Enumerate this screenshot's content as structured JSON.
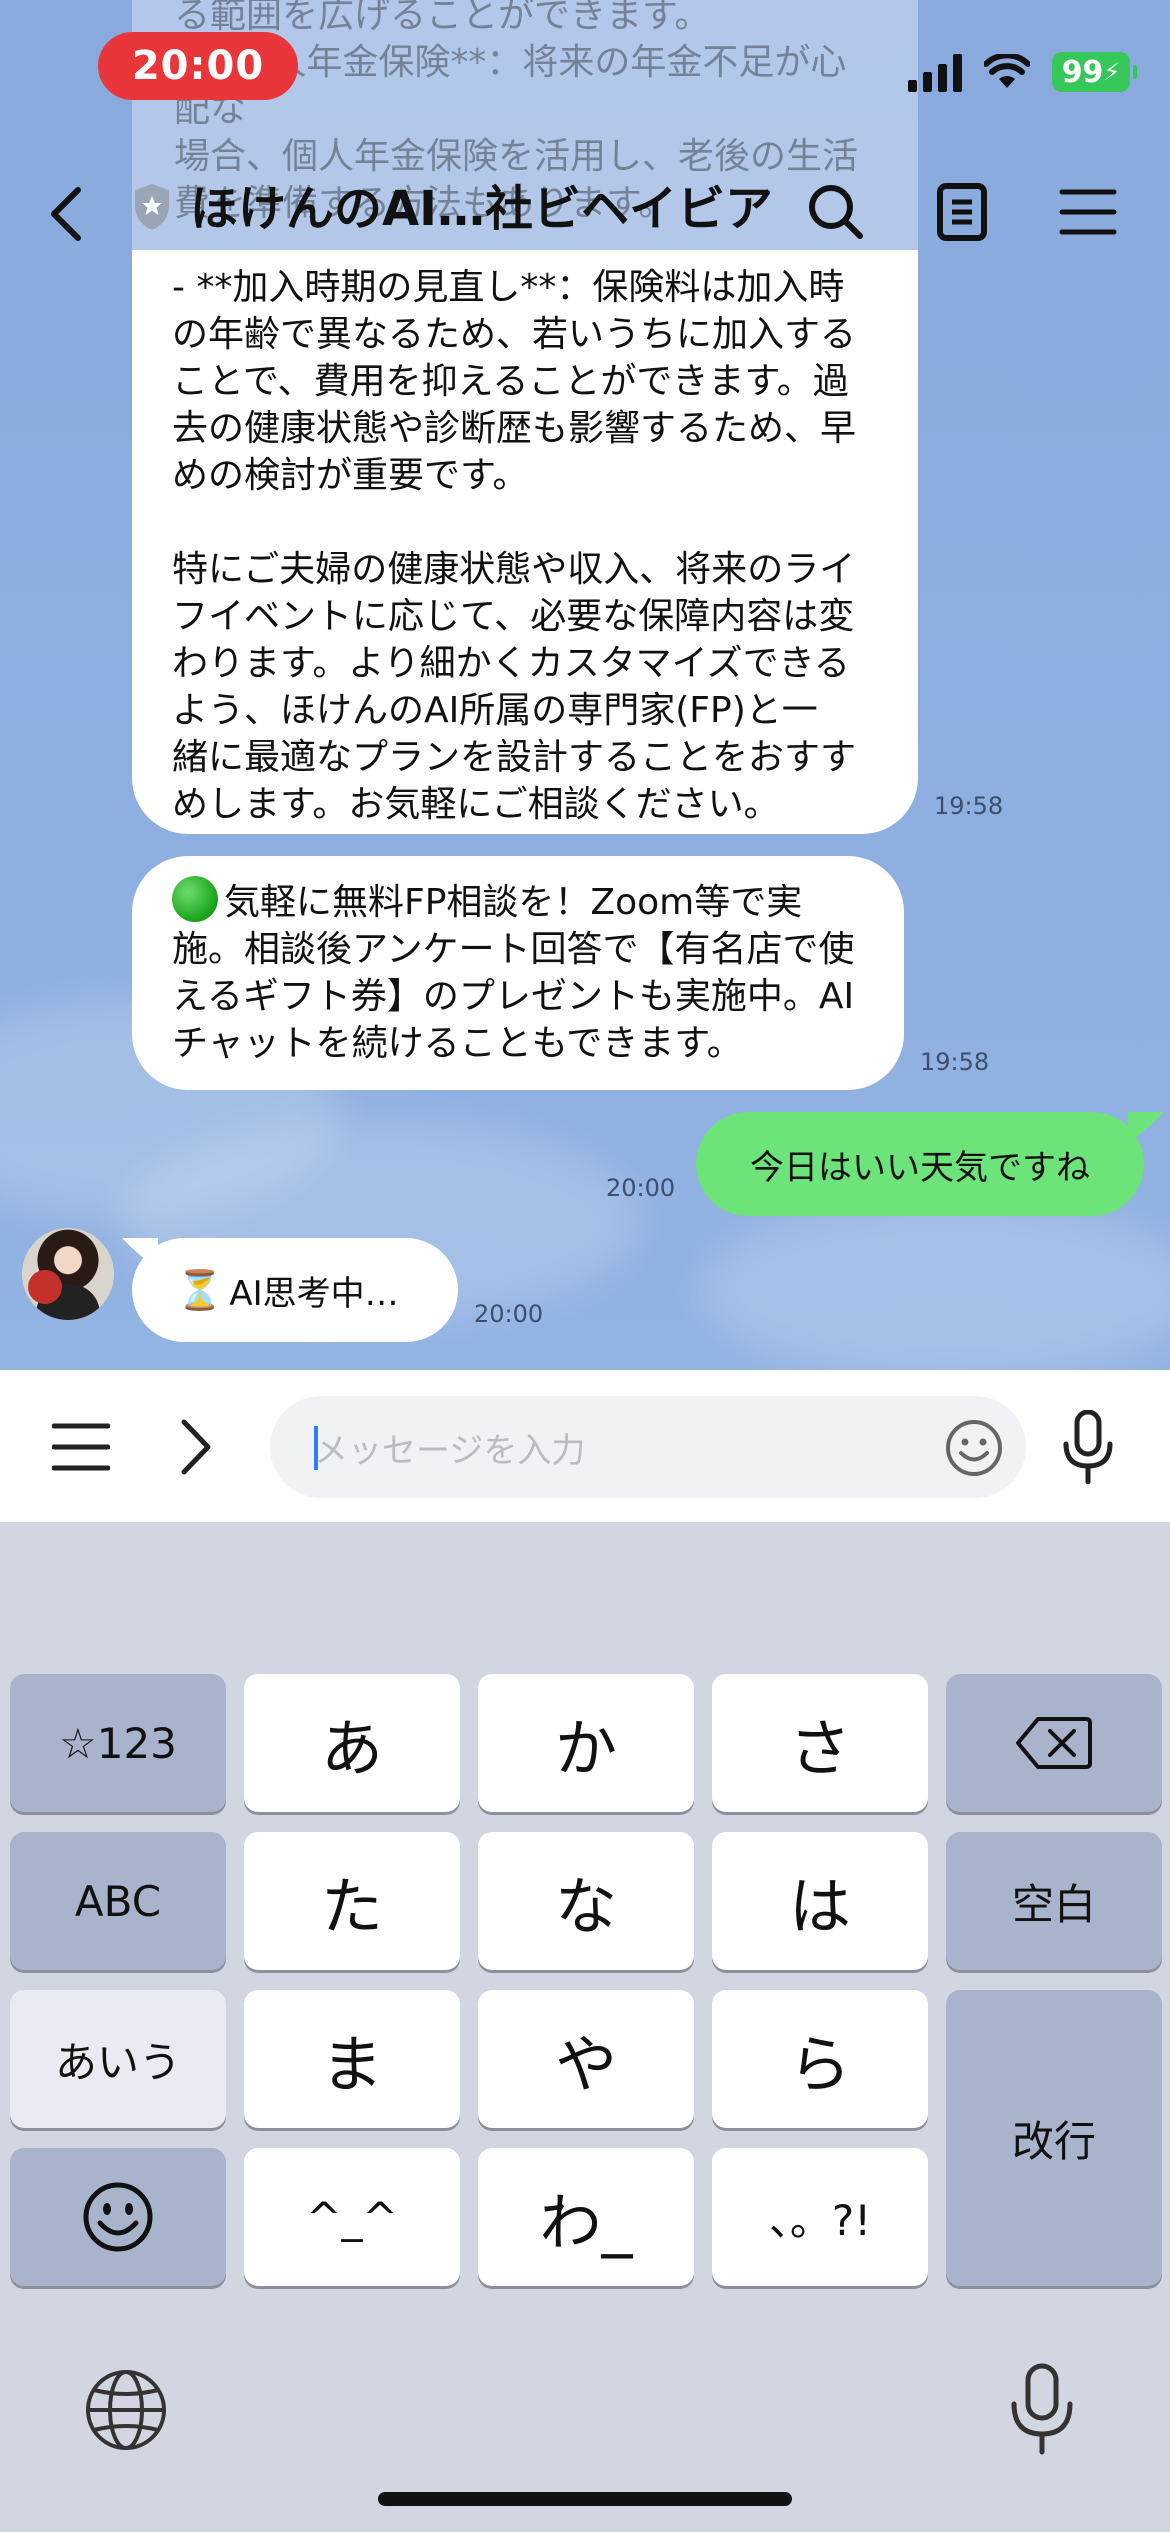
{
  "status_bar": {
    "time": "20:00",
    "battery": "99"
  },
  "header": {
    "title": "ほけんのAI…社ビヘイビア"
  },
  "faded_message": "る範囲を広げることができます。\n- **個人年金保険**：将来の年金不足が心配な\n場合、個人年金保険を活用し、老後の生活\n費を準備する方法もあります。",
  "messages": {
    "msg1": {
      "text": "- **加入時期の見直し**：保険料は加入時\nの年齢で異なるため、若いうちに加入する\nことで、費用を抑えることができます。過\n去の健康状態や診断歴も影響するため、早\nめの検討が重要です。\n\n特にご夫婦の健康状態や収入、将来のライ\nフイベントに応じて、必要な保障内容は変\nわります。より細かくカスタマイズできる\nよう、ほけんのAI所属の専門家(FP)と一\n緒に最適なプランを設計することをおすす\nめします。お気軽にご相談ください。",
      "time": "19:58"
    },
    "msg2": {
      "text": "気軽に無料FP相談を！Zoom等で実\n施。相談後アンケート回答で【有名店で使\nえるギフト券】のプレゼントも実施中。AI\nチャットを続けることもできます。",
      "time": "19:58"
    },
    "sent": {
      "text": "今日はいい天気ですね",
      "time": "20:00"
    },
    "thinking": {
      "text": "AI思考中…",
      "time": "20:00"
    }
  },
  "input": {
    "placeholder": "メッセージを入力"
  },
  "keyboard": {
    "rows": [
      [
        "☆123",
        "あ",
        "か",
        "さ",
        "⌫"
      ],
      [
        "ABC",
        "た",
        "な",
        "は",
        "空白"
      ],
      [
        "あいう",
        "ま",
        "や",
        "ら",
        "改行"
      ],
      [
        "☺",
        "^_^",
        "わ_",
        "、。?!"
      ]
    ]
  },
  "colors": {
    "chat_bg": "#8fb0df",
    "sent_bubble": "#6ce47a",
    "status_time_bg": "#e8363a",
    "battery": "#36c759"
  }
}
